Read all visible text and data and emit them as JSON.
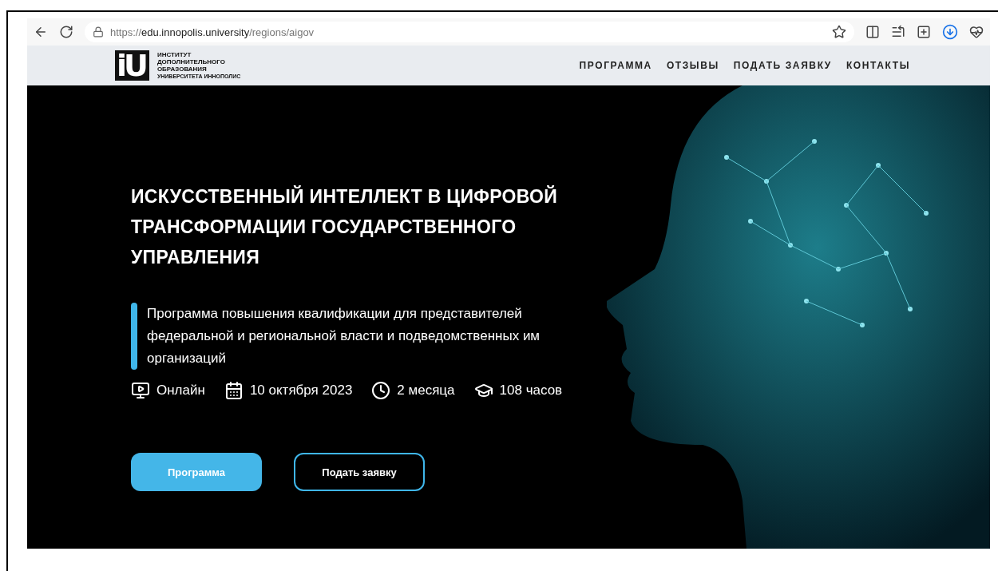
{
  "browser": {
    "url_scheme": "https://",
    "url_host": "edu.innopolis.university",
    "url_path": "/regions/aigov"
  },
  "header": {
    "logo_mark": "iU",
    "logo_lines": [
      "ИНСТИТУТ",
      "ДОПОЛНИТЕЛЬНОГО",
      "ОБРАЗОВАНИЯ"
    ],
    "logo_subline": "УНИВЕРСИТЕТА ИННОПОЛИС",
    "nav": [
      "ПРОГРАММА",
      "ОТЗЫВЫ",
      "ПОДАТЬ ЗАЯВКУ",
      "КОНТАКТЫ"
    ]
  },
  "hero": {
    "title": "ИСКУССТВЕННЫЙ ИНТЕЛЛЕКТ В ЦИФРОВОЙ ТРАНСФОРМАЦИИ ГОСУДАРСТВЕННОГО УПРАВЛЕНИЯ",
    "subtitle": "Программа повышения квалификации для представителей федеральной и региональной власти и подведомственных им организаций",
    "facts": [
      {
        "kind": "format",
        "text": "Онлайн"
      },
      {
        "kind": "date",
        "text": "10 октября 2023"
      },
      {
        "kind": "duration",
        "text": "2 месяца"
      },
      {
        "kind": "hours",
        "text": "108 часов"
      }
    ],
    "buttons": [
      {
        "kind": "primary",
        "label": "Программа"
      },
      {
        "kind": "outline",
        "label": "Подать заявку"
      }
    ]
  }
}
